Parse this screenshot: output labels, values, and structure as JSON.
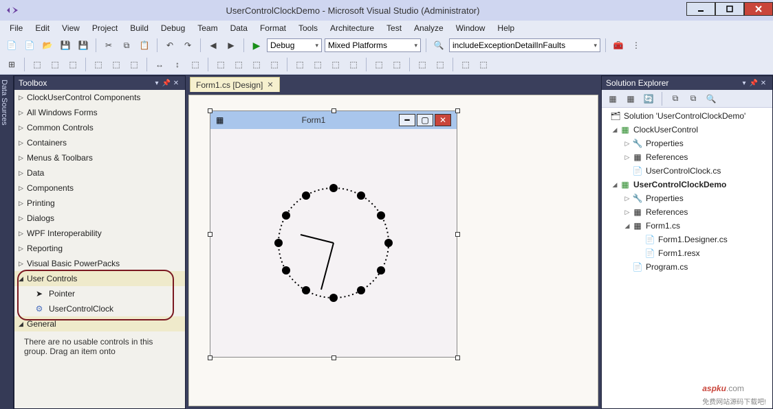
{
  "title": "UserControlClockDemo - Microsoft Visual Studio (Administrator)",
  "menu": [
    "File",
    "Edit",
    "View",
    "Project",
    "Build",
    "Debug",
    "Team",
    "Data",
    "Format",
    "Tools",
    "Architecture",
    "Test",
    "Analyze",
    "Window",
    "Help"
  ],
  "toolbar": {
    "config": "Debug",
    "platform": "Mixed Platforms",
    "findbox": "includeExceptionDetailInFaults"
  },
  "side_tab": "Data Sources",
  "toolbox": {
    "title": "Toolbox",
    "groups_collapsed": [
      "ClockUserControl Components",
      "All Windows Forms",
      "Common Controls",
      "Containers",
      "Menus & Toolbars",
      "Data",
      "Components",
      "Printing",
      "Dialogs",
      "WPF Interoperability",
      "Reporting",
      "Visual Basic PowerPacks"
    ],
    "user_controls_group": "User Controls",
    "user_controls_items": [
      {
        "icon": "pointer",
        "label": "Pointer"
      },
      {
        "icon": "gear",
        "label": "UserControlClock"
      }
    ],
    "general_group": "General",
    "empty_msg": "There are no usable controls in this group. Drag an item onto"
  },
  "doc_tab": "Form1.cs [Design]",
  "form": {
    "title": "Form1"
  },
  "solution_explorer": {
    "title": "Solution Explorer",
    "root": "Solution 'UserControlClockDemo'",
    "proj1": "ClockUserControl",
    "p1_props": "Properties",
    "p1_refs": "References",
    "p1_file": "UserControlClock.cs",
    "proj2": "UserControlClockDemo",
    "p2_props": "Properties",
    "p2_refs": "References",
    "p2_form": "Form1.cs",
    "p2_form_des": "Form1.Designer.cs",
    "p2_form_resx": "Form1.resx",
    "p2_program": "Program.cs"
  },
  "watermark": {
    "brand": "aspku",
    "dom": ".com",
    "sub": "免费网站源码下载吧!"
  }
}
